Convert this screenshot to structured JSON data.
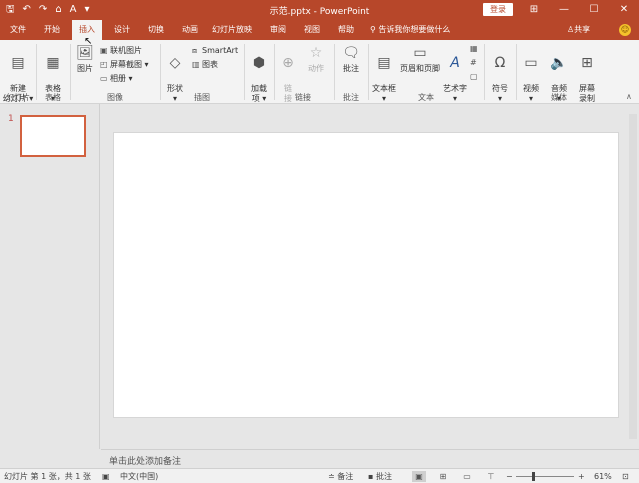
{
  "titlebar": {
    "qat": {
      "save": "🖫",
      "undo": "↶",
      "redo": "↷",
      "extra": "⌂",
      "font": "A",
      "more": "▾"
    },
    "title": "示范.pptx - PowerPoint",
    "login": "登录",
    "ribbon_opts": "⊞",
    "minimize": "—",
    "maximize": "☐",
    "close": "✕"
  },
  "tabs": {
    "file": "文件",
    "home": "开始",
    "insert": "插入",
    "design": "设计",
    "transitions": "切换",
    "animations": "动画",
    "slideshow": "幻灯片放映",
    "review": "审阅",
    "view": "视图",
    "help": "帮助",
    "tell_me": "告诉我你想要做什么",
    "share": "共享"
  },
  "ribbon": {
    "new_slide": "新建\n幻灯片 ▾",
    "table": "表格\n▾",
    "pictures": "图片",
    "online_pictures": "联机图片",
    "screenshot": "屏幕截图 ▾",
    "album": "相册 ▾",
    "shapes": "形状\n▾",
    "smartart": "SmartArt",
    "chart": "图表",
    "addins": "加载\n项 ▾",
    "link": "链\n接",
    "action": "动作",
    "comment": "批注",
    "textbox": "文本框\n▾",
    "header_footer": "页眉和页脚",
    "wordart": "艺术字\n▾",
    "symbol": "符号\n▾",
    "video": "视频\n▾",
    "audio": "音频\n▾",
    "screen_record": "屏幕\n录制",
    "groups": {
      "slides": "幻灯片",
      "tables": "表格",
      "images": "图像",
      "illustrations": "插图",
      "links": "链接",
      "comments": "批注",
      "text": "文本",
      "media": "媒体"
    }
  },
  "thumbs": {
    "slide_number": "1"
  },
  "notes": {
    "placeholder": "单击此处添加备注"
  },
  "status": {
    "slide_info": "幻灯片 第 1 张，共 1 张",
    "language": "中文(中国)",
    "notes_btn": "备注",
    "comments_btn": "批注",
    "zoom_minus": "−",
    "zoom_plus": "+",
    "zoom_level": "61%"
  }
}
